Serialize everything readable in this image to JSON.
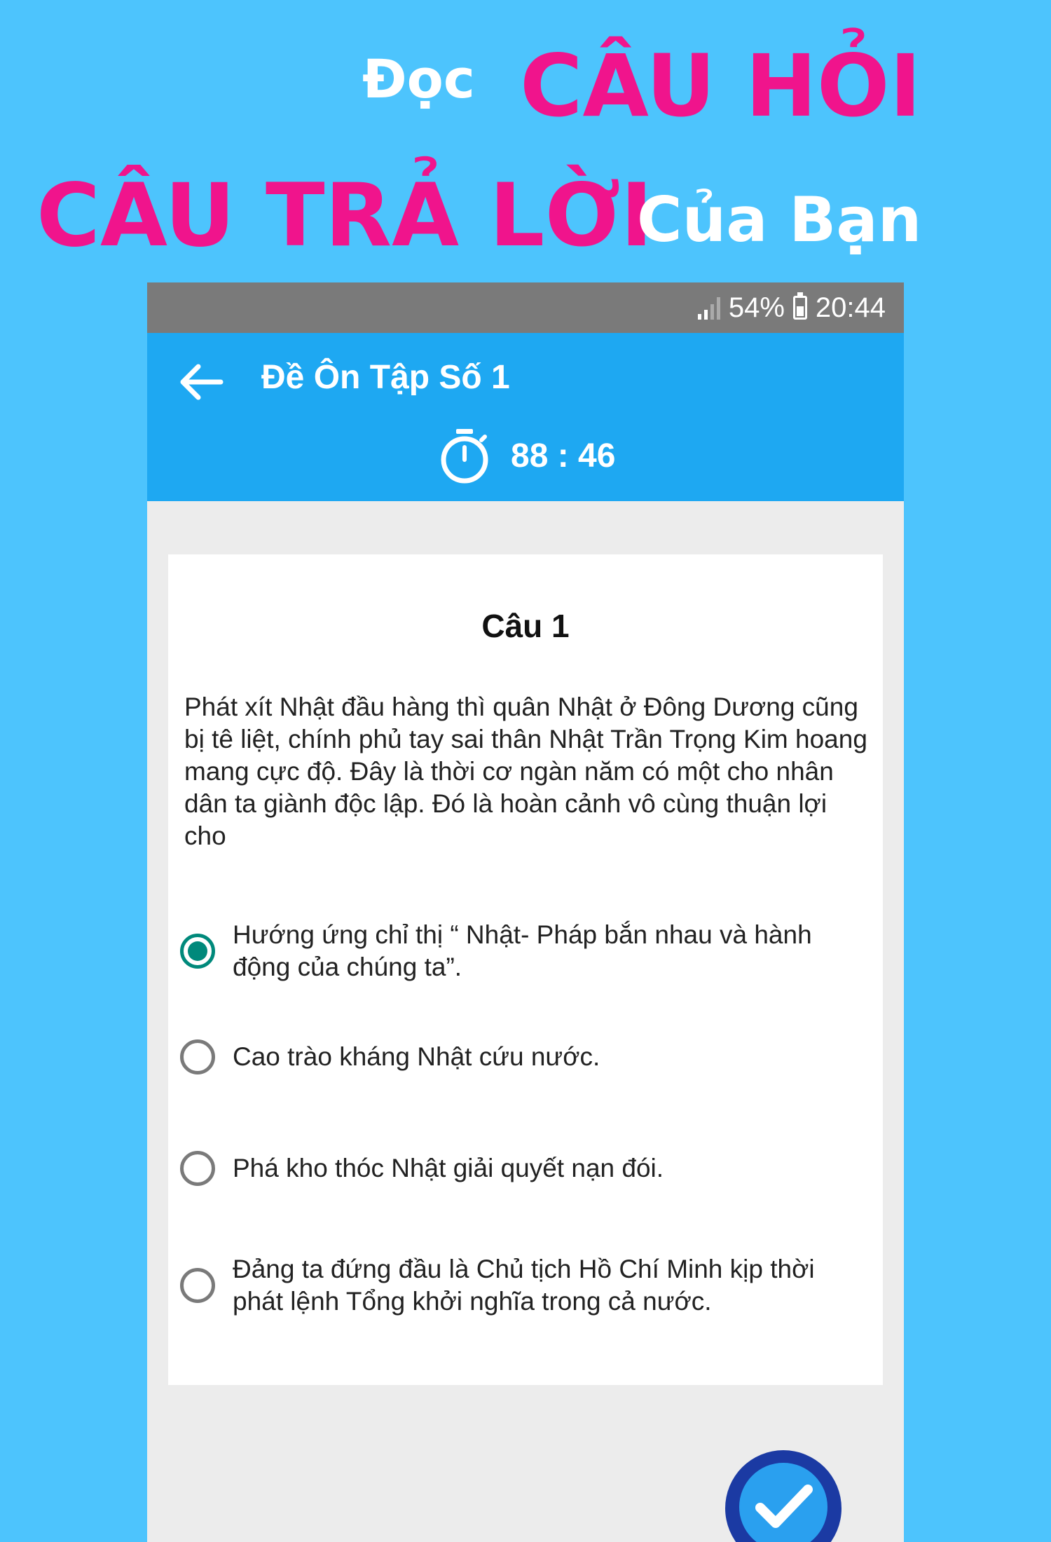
{
  "promo": {
    "line1_prefix": "Đọc",
    "line1_highlight": "CÂU HỎI",
    "line2_highlight": "CÂU TRẢ LỜI",
    "line2_suffix": "Của Bạn",
    "colors": {
      "white": "#ffffff",
      "pink": "#f0148c",
      "background": "#4dc4fd"
    }
  },
  "status_bar": {
    "battery": "54%",
    "time": "20:44"
  },
  "app_bar": {
    "back_icon": "arrow-left-icon",
    "title": "Đề Ôn Tập Số 1",
    "timer_icon": "stopwatch-icon",
    "timer": "88 : 46",
    "color": "#1ea8f2"
  },
  "question": {
    "number_label": "Câu 1",
    "text": "Phát xít Nhật đầu hàng thì quân Nhật ở Đông Dương cũng bị tê liệt, chính phủ tay sai thân Nhật Trần Trọng Kim hoang mang cực độ. Đây là thời cơ ngàn năm có một cho nhân dân ta giành độc lập. Đó là hoàn cảnh vô cùng thuận lợi cho",
    "options": [
      {
        "label": "Hướng ứng chỉ thị “ Nhật- Pháp bắn nhau và hành động của chúng ta”.",
        "selected": true
      },
      {
        "label": "Cao trào kháng Nhật cứu nước.",
        "selected": false
      },
      {
        "label": "Phá kho thóc Nhật giải quyết nạn đói.",
        "selected": false
      },
      {
        "label": " Đảng ta đứng đầu là Chủ tịch Hồ Chí Minh kịp thời phát lệnh Tổng khởi nghĩa trong cả nước.",
        "selected": false
      }
    ],
    "selected_color": "#00897b"
  },
  "submit_button": {
    "icon": "checkmark-icon"
  }
}
